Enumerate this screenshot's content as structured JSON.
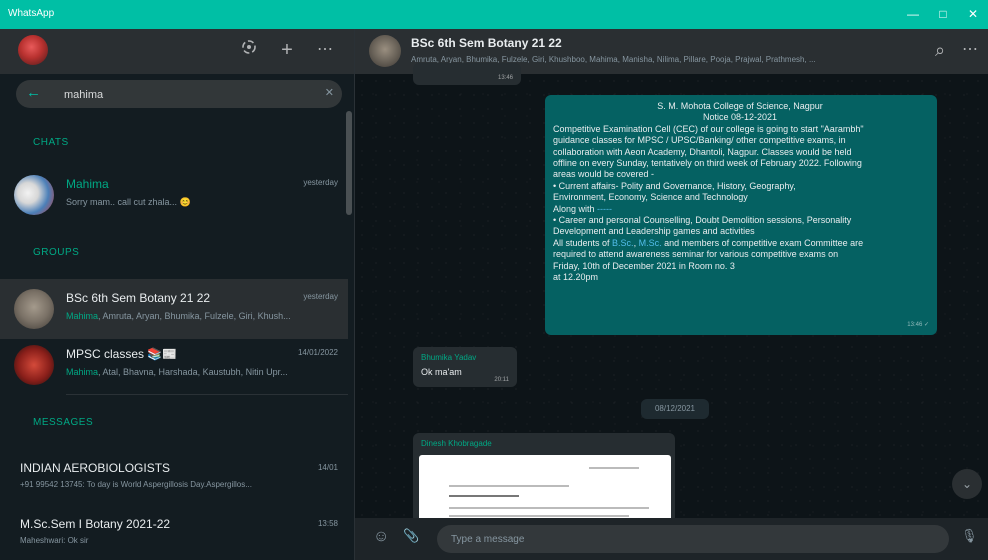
{
  "window": {
    "title": "WhatsApp",
    "minimize": "—",
    "maximize": "□",
    "close": "✕"
  },
  "colors": {
    "accent": "#00bfa5",
    "outgoing": "#056162",
    "incoming": "#262d31",
    "highlight": "#00a884"
  },
  "sidebar": {
    "icons": {
      "status": "status-icon",
      "new_chat": "+",
      "menu": "⋯"
    },
    "search": {
      "value": "mahima",
      "back": "←",
      "clear": "✕"
    },
    "sections": {
      "chats": "CHATS",
      "groups": "GROUPS",
      "messages": "MESSAGES"
    },
    "chats": [
      {
        "name": "Mahima",
        "time": "yesterday",
        "preview": "Sorry mam.. call cut zhala... 😊"
      }
    ],
    "groups": [
      {
        "name": "BSc 6th Sem Botany 21 22",
        "time": "yesterday",
        "highlight": "Mahima",
        "preview": ", Amruta, Aryan, Bhumika, Fulzele, Giri, Khush..."
      },
      {
        "name": "MPSC classes 📚📰",
        "time": "14/01/2022",
        "highlight": "Mahima",
        "preview": ", Atal, Bhavna, Harshada, Kaustubh, Nitin Upr..."
      }
    ],
    "messages": [
      {
        "name": "INDIAN AEROBIOLOGISTS",
        "time": "14/01",
        "preview": "+91 99542 13745: To day is World Aspergillosis Day.Aspergillos..."
      },
      {
        "name": "M.Sc.Sem I Botany 2021-22",
        "time": "13:58",
        "preview": "Maheshwari: Ok sir"
      }
    ]
  },
  "chat": {
    "title": "BSc 6th Sem Botany 21 22",
    "participants": "Amruta, Aryan, Bhumika, Fulzele, Giri, Khushboo, Mahima, Manisha, Nilima, Pillare, Pooja, Prajwal, Prathmesh, ...",
    "header_icons": {
      "search": "⌕",
      "menu": "⋯"
    },
    "prev_msg_time": "13:46",
    "notice": {
      "lines": [
        "S. M. Mohota College of Science, Nagpur",
        "Notice                                08-12-2021",
        " Competitive Examination Cell (CEC) of our college is going to start \"Aarambh\"",
        "guidance classes for MPSC / UPSC/Banking/ other competitive exams, in",
        "collaboration with Aeon Academy, Dhantoli, Nagpur.  Classes would be held",
        "offline on every Sunday, tentatively on third week of February 2022. Following",
        "areas would be covered -",
        "•     Current affairs-    Polity and Governance, History, Geography,",
        "Environment, Economy, Science and Technology",
        "•     Career and personal Counselling, Doubt Demolition sessions, Personality",
        "Development and Leadership games and activities",
        "and members of competitive exam Committee are",
        "required to attend awareness seminar for various competitive exams on",
        "Friday,  10th of December 2021                          in Room no. 3",
        "at 12.20pm"
      ],
      "along_with": "Along with",
      "along_with_link": "-----",
      "all_students": "All students of ",
      "link_bsc": "B.Sc.",
      "comma": ", ",
      "link_msc": "M.Sc.",
      "time": "13:46 ✓"
    },
    "reply": {
      "sender": "Bhumika Yadav",
      "text": "Ok ma'am",
      "time": "20:11"
    },
    "date_divider": "08/12/2021",
    "doc": {
      "sender": "Dinesh Khobragade"
    },
    "composer": {
      "placeholder": "Type a message",
      "emoji": "☺",
      "attach": "📎",
      "mic": "🎙"
    },
    "scroll_down": "⌄"
  }
}
